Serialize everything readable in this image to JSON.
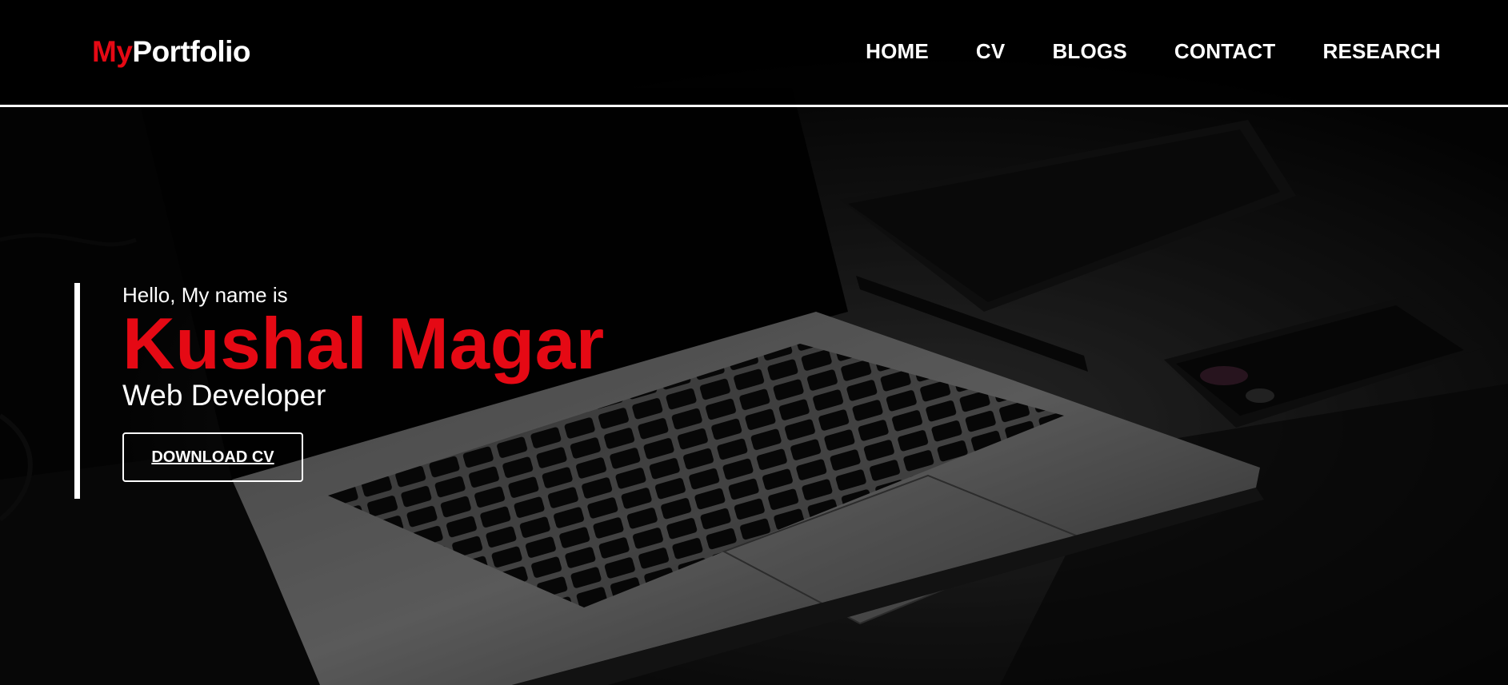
{
  "logo": {
    "accent": "My",
    "main": "Portfolio"
  },
  "nav": {
    "items": [
      {
        "label": "HOME"
      },
      {
        "label": "CV"
      },
      {
        "label": "BLOGS"
      },
      {
        "label": "CONTACT"
      },
      {
        "label": "RESEARCH"
      }
    ]
  },
  "hero": {
    "greeting": "Hello, My name is",
    "name": "Kushal Magar",
    "role": "Web Developer",
    "download_label": "DOWNLOAD CV"
  },
  "colors": {
    "accent": "#e50914",
    "text": "#ffffff",
    "background": "#000000"
  }
}
